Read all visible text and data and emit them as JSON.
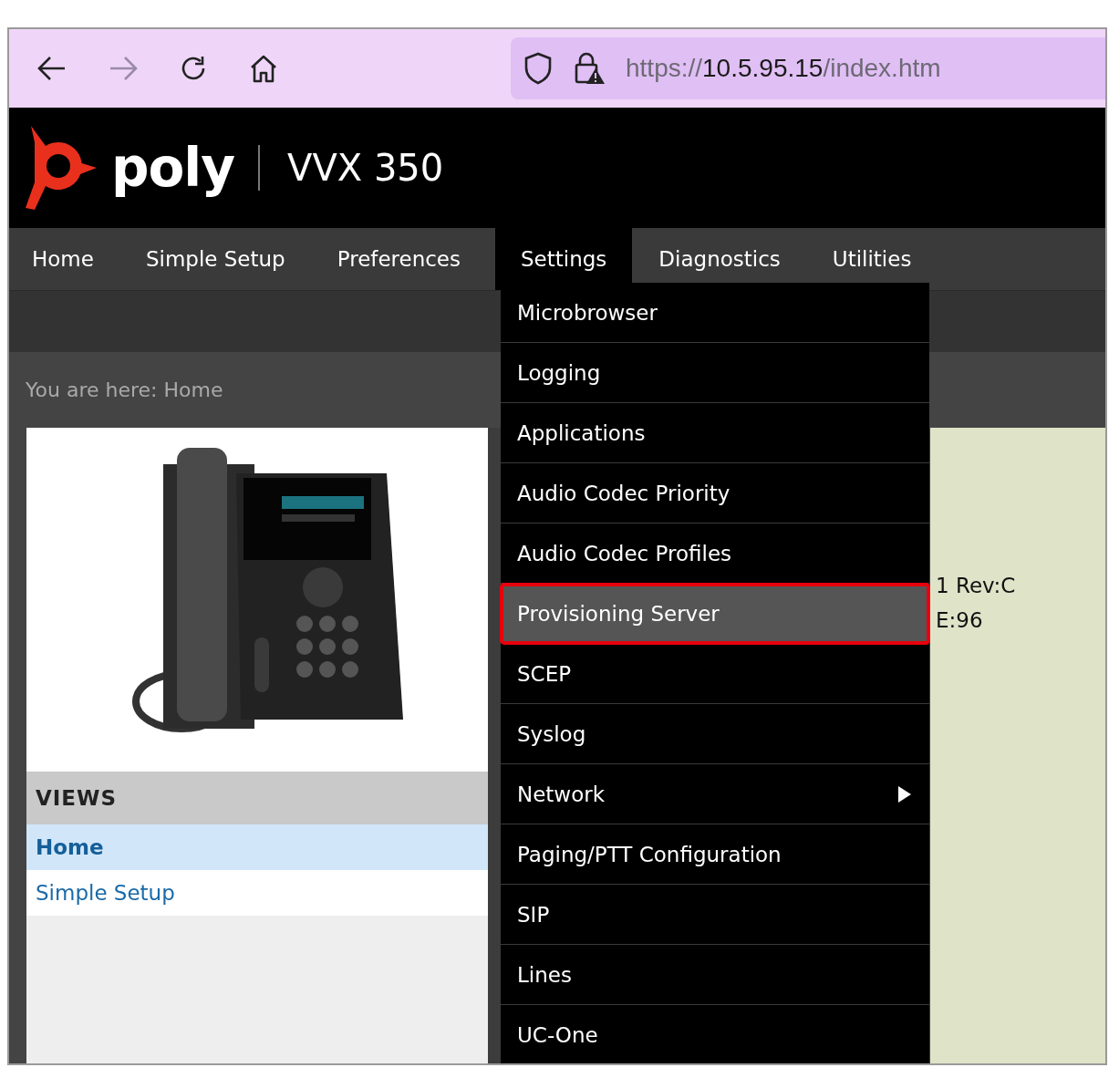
{
  "browser": {
    "url": {
      "scheme": "https://",
      "host": "10.5.95.15",
      "path": "/index.htm"
    }
  },
  "header": {
    "logo_text": "poly",
    "model": "VVX 350"
  },
  "nav": [
    {
      "label": "Home",
      "selected": false
    },
    {
      "label": "Simple Setup",
      "selected": false
    },
    {
      "label": "Preferences",
      "selected": false
    },
    {
      "label": "Settings",
      "selected": true
    },
    {
      "label": "Diagnostics",
      "selected": false
    },
    {
      "label": "Utilities",
      "selected": false
    }
  ],
  "breadcrumb": "You are here: Home",
  "views": {
    "title": "VIEWS",
    "items": [
      {
        "label": "Home",
        "selected": true
      },
      {
        "label": "Simple Setup",
        "selected": false
      }
    ]
  },
  "info_lines": [
    "1 Rev:C",
    "E:96"
  ],
  "settings_menu": [
    {
      "label": "Microbrowser",
      "selected": false,
      "submenu": false
    },
    {
      "label": "Logging",
      "selected": false,
      "submenu": false
    },
    {
      "label": "Applications",
      "selected": false,
      "submenu": false
    },
    {
      "label": "Audio Codec Priority",
      "selected": false,
      "submenu": false
    },
    {
      "label": "Audio Codec Profiles",
      "selected": false,
      "submenu": false
    },
    {
      "label": "Provisioning Server",
      "selected": true,
      "submenu": false
    },
    {
      "label": "SCEP",
      "selected": false,
      "submenu": false
    },
    {
      "label": "Syslog",
      "selected": false,
      "submenu": false
    },
    {
      "label": "Network",
      "selected": false,
      "submenu": true
    },
    {
      "label": "Paging/PTT Configuration",
      "selected": false,
      "submenu": false
    },
    {
      "label": "SIP",
      "selected": false,
      "submenu": false
    },
    {
      "label": "Lines",
      "selected": false,
      "submenu": false
    },
    {
      "label": "UC-One",
      "selected": false,
      "submenu": false
    }
  ]
}
